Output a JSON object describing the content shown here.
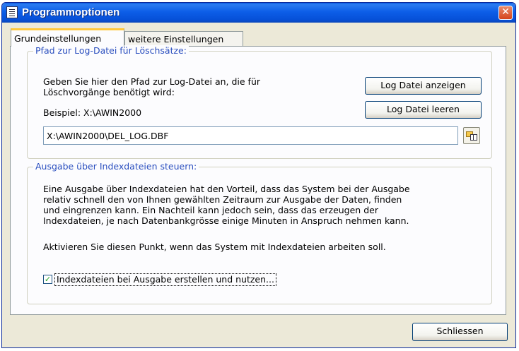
{
  "window": {
    "title": "Programmoptionen",
    "close_glyph": "✕"
  },
  "tabs": [
    {
      "label": "Grundeinstellungen",
      "active": true
    },
    {
      "label": "weitere Einstellungen",
      "active": false
    }
  ],
  "log_group": {
    "legend": "Pfad zur Log-Datei für Löschsätze:",
    "description_line1": "Geben Sie hier den Pfad zur Log-Datei an, die für",
    "description_line2": "Löschvorgänge benötigt wird:",
    "example": "Beispiel: X:\\AWIN2000",
    "path_value": "X:\\AWIN2000\\DEL_LOG.DBF",
    "show_button": "Log Datei anzeigen",
    "clear_button": "Log Datei leeren",
    "browse_icon": "folder-browse-icon"
  },
  "index_group": {
    "legend": "Ausgabe über Indexdateien steuern:",
    "para_line1": "Eine Ausgabe über Indexdateien hat den Vorteil, dass das System bei der Ausgabe",
    "para_line2": "relativ schnell den von Ihnen gewählten Zeitraum zur Ausgabe der Daten, finden",
    "para_line3": "und eingrenzen kann. Ein Nachteil kann jedoch sein, dass das erzeugen der",
    "para_line4": "Indexdateien, je nach Datenbankgrösse einige Minuten in Anspruch nehmen kann.",
    "activate_text": "Aktivieren Sie diesen Punkt, wenn das System mit Indexdateien arbeiten soll.",
    "checkbox_label": "Indexdateien bei Ausgabe erstellen und nutzen...",
    "checkbox_checked": true,
    "check_glyph": "✓"
  },
  "footer": {
    "close_button": "Schliessen"
  },
  "colors": {
    "titlebar": "#0a5ce3",
    "legend_text": "#2b4fbf",
    "tab_highlight": "#ffc83c"
  }
}
